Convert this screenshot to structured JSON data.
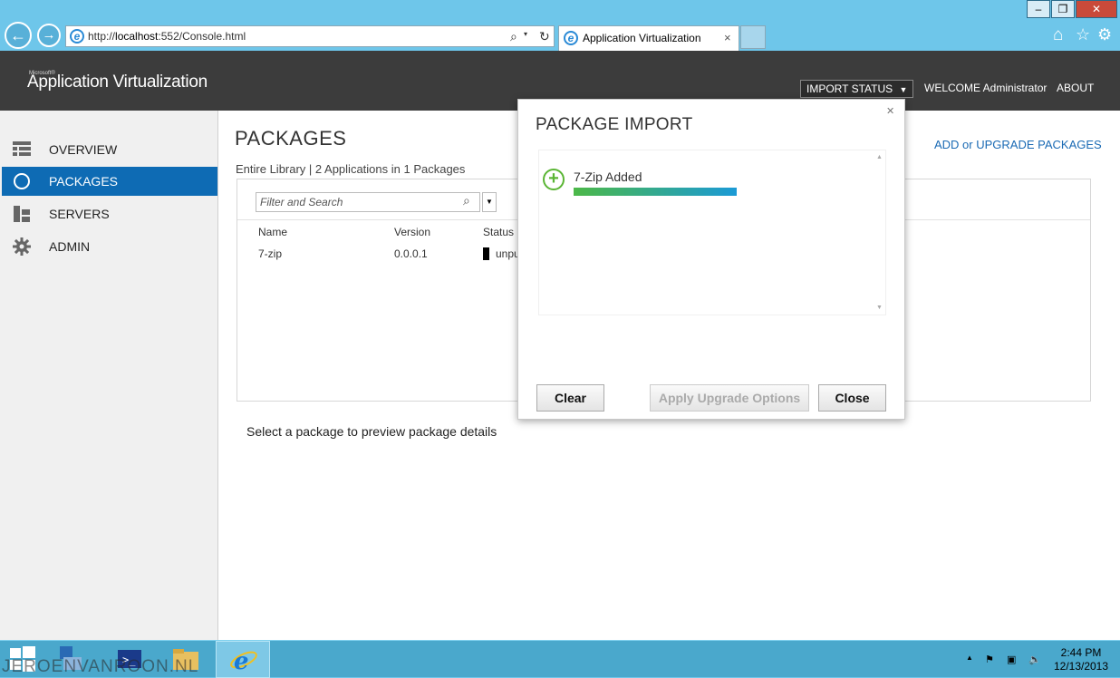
{
  "browser": {
    "url_prefix": "http://",
    "url_host": "localhost",
    "url_rest": ":552/Console.html",
    "tab_title": "Application Virtualization",
    "tab_close": "×",
    "minimize": "–",
    "restore": "❐",
    "close": "✕",
    "back": "←",
    "forward": "→",
    "home_icon": "⌂",
    "favorites_icon": "☆",
    "tools_icon": "⚙",
    "search_icon": "⌕",
    "refresh_icon": "↻"
  },
  "header": {
    "brand_small": "Microsoft®",
    "brand": "Application Virtualization",
    "import_status": "IMPORT STATUS",
    "welcome": "WELCOME Administrator",
    "about": "ABOUT"
  },
  "sidebar": {
    "items": [
      {
        "label": "OVERVIEW"
      },
      {
        "label": "PACKAGES"
      },
      {
        "label": "SERVERS"
      },
      {
        "label": "ADMIN"
      }
    ]
  },
  "main": {
    "title": "PACKAGES",
    "subtitle": "Entire Library | 2 Applications in 1 Packages",
    "add_upgrade": "ADD or UPGRADE PACKAGES",
    "search_placeholder": "Filter and Search",
    "columns": [
      "Name",
      "Version",
      "Status"
    ],
    "rows": [
      {
        "name": "7-zip",
        "version": "0.0.0.1",
        "status": "unpu"
      }
    ],
    "preview_msg": "Select a package to preview package details"
  },
  "dialog": {
    "title": "PACKAGE IMPORT",
    "close_glyph": "✕",
    "item_label": "7-Zip Added",
    "item_progress": 1.0,
    "buttons": {
      "clear": "Clear",
      "apply": "Apply Upgrade Options",
      "close": "Close"
    }
  },
  "taskbar": {
    "watermark": "JEROENVANROON.NL",
    "time": "2:44 PM",
    "date": "12/13/2013"
  },
  "colors": {
    "accent": "#0e6bb4",
    "header_bg": "#3c3c3c",
    "progress_start": "#4cb848",
    "progress_end": "#1b9ad6",
    "taskbar": "#4aa8cc"
  }
}
